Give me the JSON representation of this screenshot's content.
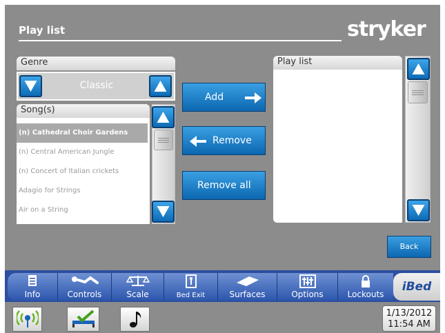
{
  "header": {
    "title": "Play list",
    "brand": "stryker"
  },
  "genre": {
    "label": "Genre",
    "value": "Classic"
  },
  "songs": {
    "label": "Song(s)",
    "items": [
      {
        "title": "(n) Cathedral Choir Gardens",
        "selected": true
      },
      {
        "title": "(n) Central American Jungle",
        "selected": false
      },
      {
        "title": "(n) Concert of Italian crickets",
        "selected": false
      },
      {
        "title": "Adagio for Strings",
        "selected": false
      },
      {
        "title": "Air on a String",
        "selected": false
      }
    ]
  },
  "actions": {
    "add": "Add",
    "remove": "Remove",
    "remove_all": "Remove all"
  },
  "playlist": {
    "label": "Play list",
    "items": []
  },
  "back_label": "Back",
  "nav": {
    "tabs": [
      {
        "label": "Info",
        "icon": "info-icon"
      },
      {
        "label": "Controls",
        "icon": "patient-controls-icon"
      },
      {
        "label": "Scale",
        "icon": "scale-icon"
      },
      {
        "label": "Bed Exit",
        "icon": "bed-exit-icon"
      },
      {
        "label": "Surfaces",
        "icon": "surfaces-icon"
      },
      {
        "label": "Options",
        "icon": "options-sliders-icon"
      },
      {
        "label": "Lockouts",
        "icon": "lock-icon"
      }
    ],
    "brand_tab": "iBed"
  },
  "status": {
    "icons": [
      "wireless-icon",
      "bed-status-icon",
      "music-note-icon"
    ],
    "date": "1/13/2012",
    "time": "11:54 AM"
  },
  "colors": {
    "accent_blue": "#0d6bb5",
    "nav_blue": "#2c56ad",
    "background": "#8c8c8c"
  }
}
